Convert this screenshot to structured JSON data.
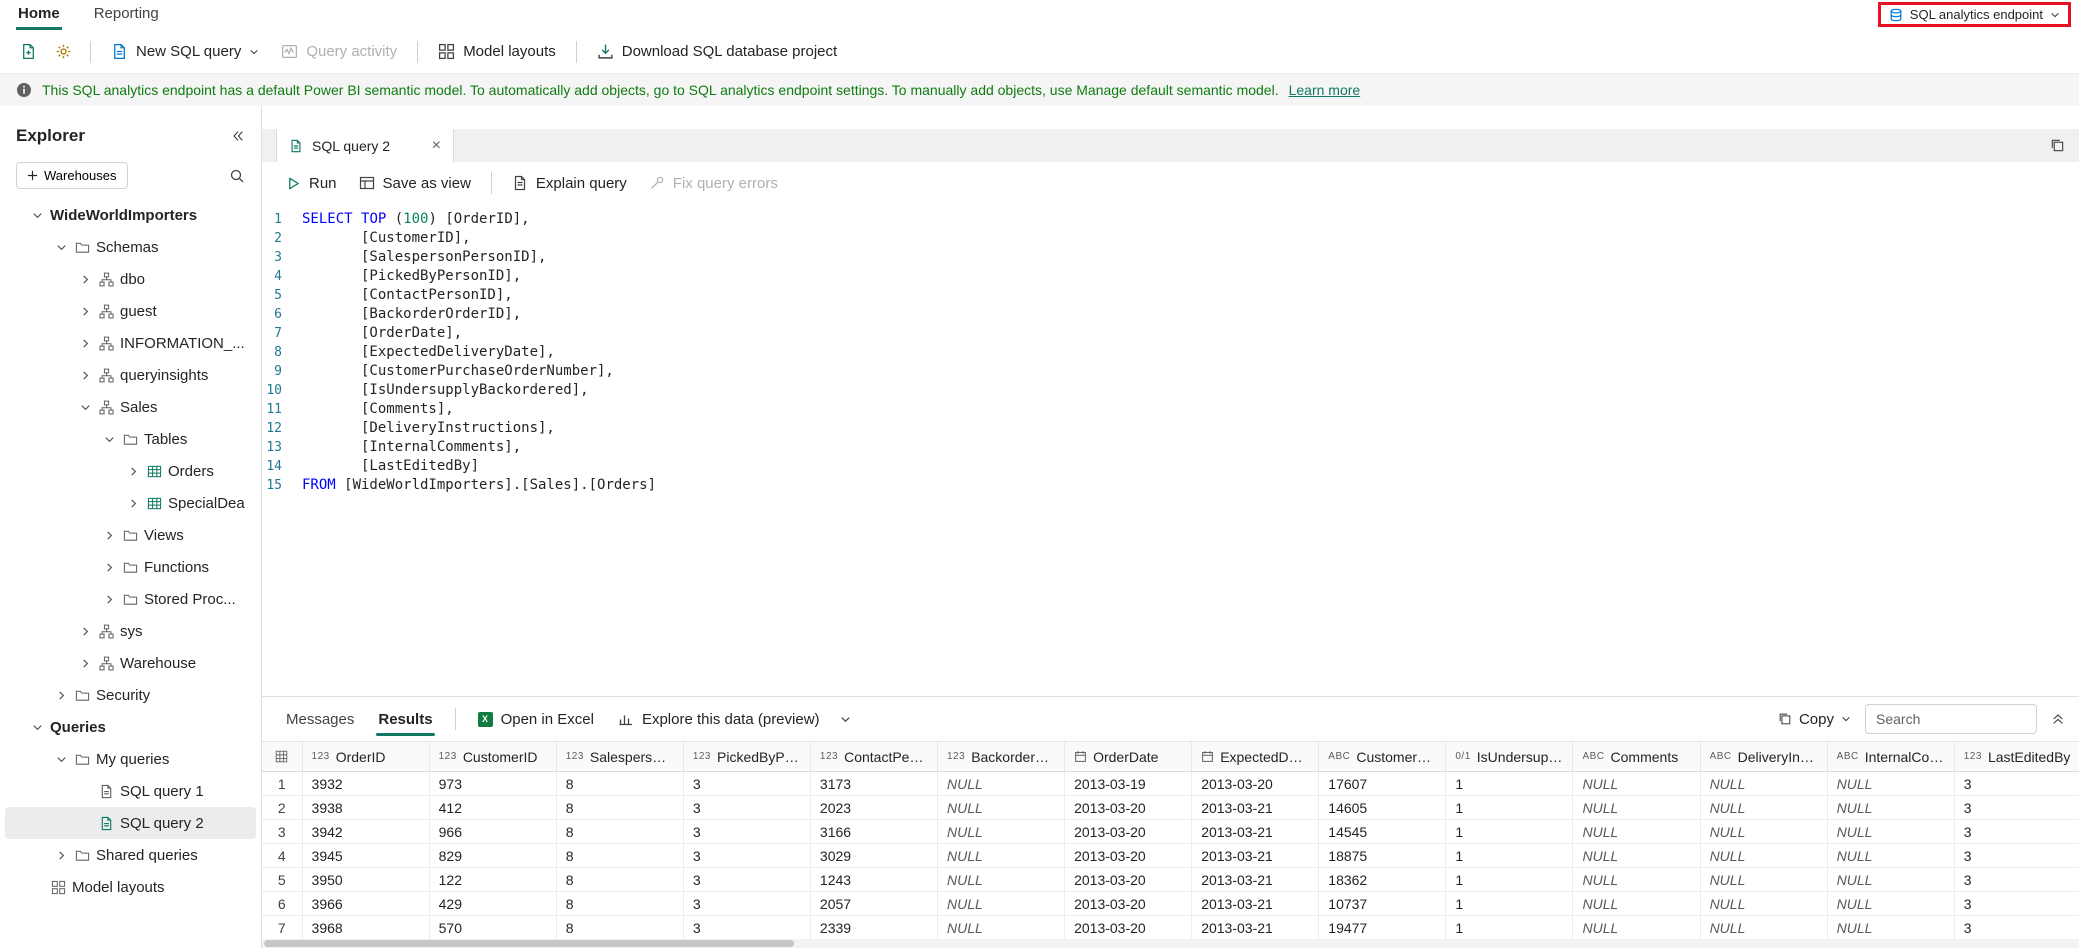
{
  "top_nav": {
    "tabs": [
      {
        "label": "Home"
      },
      {
        "label": "Reporting"
      }
    ],
    "active_tab": "Home",
    "endpoint_selector": "SQL analytics endpoint"
  },
  "toolbar": {
    "new_sql_query": "New SQL query",
    "query_activity": "Query activity",
    "model_layouts": "Model layouts",
    "download_project": "Download SQL database project"
  },
  "banner": {
    "text": "This SQL analytics endpoint has a default Power BI semantic model. To automatically add objects, go to SQL analytics endpoint settings. To manually add objects, use Manage default semantic model.",
    "link": "Learn more"
  },
  "explorer": {
    "title": "Explorer",
    "warehouses_button": "Warehouses",
    "tree": [
      {
        "label": "WideWorldImporters",
        "depth": 0,
        "chev": "down",
        "bold": true
      },
      {
        "label": "Schemas",
        "depth": 1,
        "chev": "down",
        "icon": "folder"
      },
      {
        "label": "dbo",
        "depth": 2,
        "chev": "right",
        "icon": "schema"
      },
      {
        "label": "guest",
        "depth": 2,
        "chev": "right",
        "icon": "schema"
      },
      {
        "label": "INFORMATION_...",
        "depth": 2,
        "chev": "right",
        "icon": "schema"
      },
      {
        "label": "queryinsights",
        "depth": 2,
        "chev": "right",
        "icon": "schema"
      },
      {
        "label": "Sales",
        "depth": 2,
        "chev": "down",
        "icon": "schema"
      },
      {
        "label": "Tables",
        "depth": 3,
        "chev": "down",
        "icon": "folder"
      },
      {
        "label": "Orders",
        "depth": 4,
        "chev": "right",
        "icon": "table",
        "iconColor": "#117865"
      },
      {
        "label": "SpecialDea",
        "depth": 4,
        "chev": "right",
        "icon": "table",
        "iconColor": "#117865"
      },
      {
        "label": "Views",
        "depth": 3,
        "chev": "right",
        "icon": "folder"
      },
      {
        "label": "Functions",
        "depth": 3,
        "chev": "right",
        "icon": "folder"
      },
      {
        "label": "Stored Proc...",
        "depth": 3,
        "chev": "right",
        "icon": "folder"
      },
      {
        "label": "sys",
        "depth": 2,
        "chev": "right",
        "icon": "schema"
      },
      {
        "label": "Warehouse",
        "depth": 2,
        "chev": "right",
        "icon": "schema"
      },
      {
        "label": "Security",
        "depth": 1,
        "chev": "right",
        "icon": "folder"
      },
      {
        "label": "Queries",
        "depth": 0,
        "chev": "down",
        "bold": true
      },
      {
        "label": "My queries",
        "depth": 1,
        "chev": "down",
        "icon": "folder"
      },
      {
        "label": "SQL query 1",
        "depth": 2,
        "chev": "none",
        "icon": "query"
      },
      {
        "label": "SQL query 2",
        "depth": 2,
        "chev": "none",
        "icon": "query",
        "iconColor": "#117865",
        "selected": true
      },
      {
        "label": "Shared queries",
        "depth": 1,
        "chev": "right",
        "icon": "folder"
      },
      {
        "label": "Model layouts",
        "depth": 0,
        "chev": "none",
        "icon": "model"
      }
    ]
  },
  "editor": {
    "tab_title": "SQL query 2",
    "toolbar": {
      "run": "Run",
      "save_as_view": "Save as view",
      "explain_query": "Explain query",
      "fix_query_errors": "Fix query errors"
    },
    "lines": [
      [
        {
          "c": "kw",
          "t": "SELECT"
        },
        {
          "t": " "
        },
        {
          "c": "kw",
          "t": "TOP"
        },
        {
          "t": " ("
        },
        {
          "c": "num",
          "t": "100"
        },
        {
          "t": ") [OrderID],"
        }
      ],
      [
        {
          "t": "       [CustomerID],"
        }
      ],
      [
        {
          "t": "       [SalespersonPersonID],"
        }
      ],
      [
        {
          "t": "       [PickedByPersonID],"
        }
      ],
      [
        {
          "t": "       [ContactPersonID],"
        }
      ],
      [
        {
          "t": "       [BackorderOrderID],"
        }
      ],
      [
        {
          "t": "       [OrderDate],"
        }
      ],
      [
        {
          "t": "       [ExpectedDeliveryDate],"
        }
      ],
      [
        {
          "t": "       [CustomerPurchaseOrderNumber],"
        }
      ],
      [
        {
          "t": "       [IsUndersupplyBackordered],"
        }
      ],
      [
        {
          "t": "       [Comments],"
        }
      ],
      [
        {
          "t": "       [DeliveryInstructions],"
        }
      ],
      [
        {
          "t": "       [InternalComments],"
        }
      ],
      [
        {
          "t": "       [LastEditedBy]"
        }
      ],
      [
        {
          "c": "kw",
          "t": "FROM"
        },
        {
          "t": " [WideWorldImporters].[Sales].[Orders]"
        }
      ]
    ]
  },
  "results": {
    "tabs": {
      "messages": "Messages",
      "results": "Results"
    },
    "open_in_excel": "Open in Excel",
    "explore": "Explore this data (preview)",
    "copy": "Copy",
    "search_placeholder": "Search",
    "columns": [
      {
        "type": "123",
        "label": "OrderID"
      },
      {
        "type": "123",
        "label": "CustomerID"
      },
      {
        "type": "123",
        "label": "SalespersonPe..."
      },
      {
        "type": "123",
        "label": "PickedByPers..."
      },
      {
        "type": "123",
        "label": "ContactPerso..."
      },
      {
        "type": "123",
        "label": "BackorderOrd..."
      },
      {
        "type": "date",
        "label": "OrderDate"
      },
      {
        "type": "date",
        "label": "ExpectedDeliv..."
      },
      {
        "type": "abc",
        "label": "CustomerPurc..."
      },
      {
        "type": "bit",
        "label": "IsUndersupply..."
      },
      {
        "type": "abc",
        "label": "Comments"
      },
      {
        "type": "abc",
        "label": "DeliveryInstru..."
      },
      {
        "type": "abc",
        "label": "InternalComm..."
      },
      {
        "type": "123",
        "label": "LastEditedBy"
      }
    ],
    "rows": [
      [
        "3932",
        "973",
        "8",
        "3",
        "3173",
        "NULL",
        "2013-03-19",
        "2013-03-20",
        "17607",
        "1",
        "NULL",
        "NULL",
        "NULL",
        "3"
      ],
      [
        "3938",
        "412",
        "8",
        "3",
        "2023",
        "NULL",
        "2013-03-20",
        "2013-03-21",
        "14605",
        "1",
        "NULL",
        "NULL",
        "NULL",
        "3"
      ],
      [
        "3942",
        "966",
        "8",
        "3",
        "3166",
        "NULL",
        "2013-03-20",
        "2013-03-21",
        "14545",
        "1",
        "NULL",
        "NULL",
        "NULL",
        "3"
      ],
      [
        "3945",
        "829",
        "8",
        "3",
        "3029",
        "NULL",
        "2013-03-20",
        "2013-03-21",
        "18875",
        "1",
        "NULL",
        "NULL",
        "NULL",
        "3"
      ],
      [
        "3950",
        "122",
        "8",
        "3",
        "1243",
        "NULL",
        "2013-03-20",
        "2013-03-21",
        "18362",
        "1",
        "NULL",
        "NULL",
        "NULL",
        "3"
      ],
      [
        "3966",
        "429",
        "8",
        "3",
        "2057",
        "NULL",
        "2013-03-20",
        "2013-03-21",
        "10737",
        "1",
        "NULL",
        "NULL",
        "NULL",
        "3"
      ],
      [
        "3968",
        "570",
        "8",
        "3",
        "2339",
        "NULL",
        "2013-03-20",
        "2013-03-21",
        "19477",
        "1",
        "NULL",
        "NULL",
        "NULL",
        "3"
      ]
    ]
  }
}
